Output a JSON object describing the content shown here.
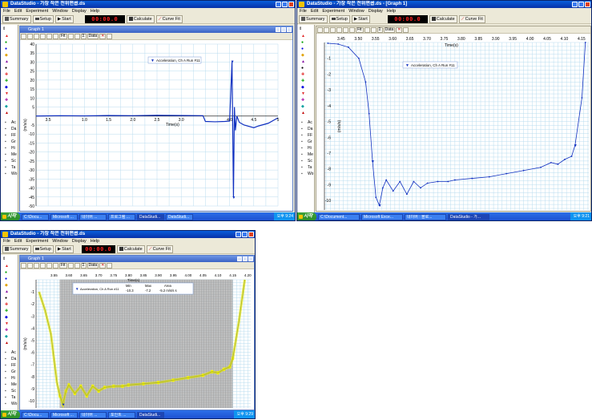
{
  "windows": [
    {
      "title": "DataStudio - 가장 작은 전위편콥.ds",
      "menu": [
        "File",
        "Edit",
        "Experiment",
        "Window",
        "Display",
        "Help"
      ],
      "toolbar": {
        "summary": "Summary",
        "setup": "Setup",
        "start": "Start",
        "timer": "00:00.0",
        "calculate": "Calculate",
        "curve_fit": "Curve Fit"
      },
      "graph_title": "Graph 1"
    },
    {
      "title": "DataStudio - 가장 작은 전위편콥.ds - [Graph 1]",
      "menu": [
        "File",
        "Edit",
        "Experiment",
        "Window",
        "Display",
        "Help"
      ],
      "toolbar": {
        "summary": "Summary",
        "setup": "Setup",
        "start": "Start",
        "timer": "00:00.0",
        "calculate": "Calculate",
        "curve_fit": "Curve Fit"
      },
      "graph_title": ""
    },
    {
      "title": "DataStudio - 가장 작은 전위편콥.ds",
      "menu": [
        "File",
        "Edit",
        "Experiment",
        "Window",
        "Display",
        "Help"
      ],
      "toolbar": {
        "summary": "Summary",
        "setup": "Setup",
        "start": "Start",
        "timer": "00:00.0",
        "calculate": "Calculate",
        "curve_fit": "Curve Fit"
      },
      "graph_title": "Graph 1"
    }
  ],
  "graph_tools": {
    "fit": "Fit",
    "data": "Data"
  },
  "sidebar_labels": [
    "Ac",
    "Da",
    "FF",
    "Gr",
    "Hi",
    "Me",
    "Sc",
    "Ta",
    "Wo"
  ],
  "graph1": {
    "legend": "Acceleration, Ch A Run #11",
    "ylabel": "(m/s/s)",
    "xlabel": "Time(s)",
    "x_ticks": [
      "3.5",
      "1.0",
      "1.5",
      "2.0",
      "2.5",
      "3.0",
      "4.0",
      "4.5",
      "5"
    ],
    "y_ticks": [
      "40",
      "35",
      "30",
      "25",
      "20",
      "15",
      "10",
      "5",
      "-5",
      "-10",
      "-15",
      "-20",
      "-25",
      "-30",
      "-35",
      "-40",
      "-45",
      "-50"
    ]
  },
  "graph2": {
    "legend": "Acceleration, Ch A Run #11",
    "ylabel": "(m/s/s)",
    "xlabel": "Time(s)",
    "x_ticks": [
      "3.45",
      "3.50",
      "3.55",
      "3.60",
      "3.65",
      "3.70",
      "3.75",
      "3.80",
      "3.85",
      "3.90",
      "3.95",
      "4.00",
      "4.05",
      "4.10",
      "4.15",
      "4.20"
    ],
    "y_ticks": [
      "-1",
      "-2",
      "-3",
      "-4",
      "-5",
      "-6",
      "-7",
      "-8",
      "-9",
      "-10"
    ]
  },
  "graph3": {
    "legend": "Acceleration, Ch A Run #11",
    "ylabel": "(m/s/s)",
    "xlabel": "Time(s)",
    "stats": {
      "min_label": "Min",
      "max_label": "Max",
      "area_label": "Area",
      "min": "-10.3",
      "max": "-7.2",
      "area": "-5.2 m/s/s s"
    },
    "x_ticks": [
      "3.55",
      "3.60",
      "3.65",
      "3.70",
      "3.75",
      "3.80",
      "3.85",
      "3.90",
      "3.95",
      "4.00",
      "4.05",
      "4.10",
      "4.15",
      "4.20"
    ],
    "y_ticks": [
      "-1",
      "-2",
      "-3",
      "-4",
      "-5",
      "-6",
      "-7",
      "-8",
      "-9",
      "-10"
    ]
  },
  "taskbars": [
    {
      "start": "시작",
      "tasks": [
        "C:\\Docu...",
        "Microsoft ...",
        "네이버 ...",
        "프로그램 ...",
        "DataStudi...",
        "DataStudi..."
      ],
      "active": 4,
      "clock": "오후 9:24"
    },
    {
      "start": "시작",
      "tasks": [
        "C:\\Document...",
        "Microsoft Exce...",
        "네이버 : 블로...",
        "DataStudio - 가..."
      ],
      "active": 3,
      "clock": "오후 9:21"
    },
    {
      "start": "시작",
      "tasks": [
        "C:\\Docu...",
        "Microsoft ...",
        "네이버 ...",
        "포인트 ...",
        "DataStudi..."
      ],
      "active": 4,
      "clock": "오후 9:29"
    }
  ],
  "chart_data": [
    {
      "type": "line",
      "title": "",
      "xlabel": "Time(s)",
      "ylabel": "(m/s/s)",
      "series": [
        {
          "name": "Acceleration, Ch A Run #11",
          "x": [
            0.0,
            0.5,
            1.0,
            1.5,
            2.0,
            2.5,
            3.0,
            3.45,
            3.5,
            3.7,
            3.9,
            4.0,
            4.05,
            4.08,
            4.1,
            4.12,
            4.15,
            4.2,
            4.3,
            4.5,
            4.6,
            4.8,
            5.0
          ],
          "y": [
            0.0,
            0.2,
            0.1,
            0.3,
            0.2,
            0.4,
            0.3,
            0.2,
            -3.0,
            -3.2,
            -3.0,
            -2.8,
            30.0,
            -45.0,
            5.0,
            -8.0,
            0.0,
            -3.5,
            -5.0,
            -6.5,
            -5.5,
            -4.0,
            -1.0
          ]
        }
      ],
      "xlim": [
        0,
        5
      ],
      "ylim": [
        -50,
        40
      ]
    },
    {
      "type": "line",
      "title": "",
      "xlabel": "Time(s)",
      "ylabel": "(m/s/s)",
      "series": [
        {
          "name": "Acceleration, Ch A Run #11",
          "x": [
            3.43,
            3.46,
            3.49,
            3.52,
            3.54,
            3.55,
            3.56,
            3.57,
            3.58,
            3.59,
            3.6,
            3.62,
            3.64,
            3.66,
            3.68,
            3.7,
            3.72,
            3.75,
            3.78,
            3.8,
            3.85,
            3.9,
            3.95,
            4.0,
            4.05,
            4.08,
            4.1,
            4.12,
            4.14,
            4.15,
            4.17,
            4.18
          ],
          "y": [
            -0.05,
            -0.1,
            -0.3,
            -1.0,
            -2.5,
            -4.5,
            -7.5,
            -9.8,
            -10.3,
            -9.2,
            -8.7,
            -9.4,
            -8.8,
            -9.6,
            -8.8,
            -9.2,
            -8.9,
            -8.8,
            -8.8,
            -8.7,
            -8.6,
            -8.5,
            -8.3,
            -8.1,
            -7.9,
            -7.6,
            -7.7,
            -7.4,
            -7.2,
            -6.5,
            -3.5,
            0.0
          ]
        }
      ],
      "xlim": [
        3.42,
        4.19
      ],
      "ylim": [
        -10.6,
        0
      ]
    },
    {
      "type": "area",
      "title": "",
      "xlabel": "Time(s)",
      "ylabel": "(m/s/s)",
      "series": [
        {
          "name": "Acceleration, Ch A Run #11",
          "x": [
            3.5,
            3.52,
            3.54,
            3.55,
            3.56,
            3.57,
            3.58,
            3.59,
            3.6,
            3.62,
            3.64,
            3.66,
            3.68,
            3.7,
            3.72,
            3.75,
            3.78,
            3.8,
            3.85,
            3.9,
            3.95,
            4.0,
            4.05,
            4.08,
            4.1,
            4.12,
            4.14,
            4.15,
            4.17,
            4.19
          ],
          "y": [
            -1.0,
            -2.5,
            -4.5,
            -6.5,
            -8.5,
            -9.6,
            -10.3,
            -9.2,
            -8.7,
            -9.4,
            -8.8,
            -9.6,
            -8.8,
            -9.2,
            -8.9,
            -8.8,
            -8.8,
            -8.7,
            -8.6,
            -8.5,
            -8.3,
            -8.1,
            -7.9,
            -7.6,
            -7.7,
            -7.4,
            -7.2,
            -6.5,
            -3.5,
            0.0
          ]
        }
      ],
      "xlim": [
        3.49,
        4.21
      ],
      "ylim": [
        -10.6,
        0
      ],
      "selection": [
        3.57,
        4.15
      ]
    }
  ]
}
